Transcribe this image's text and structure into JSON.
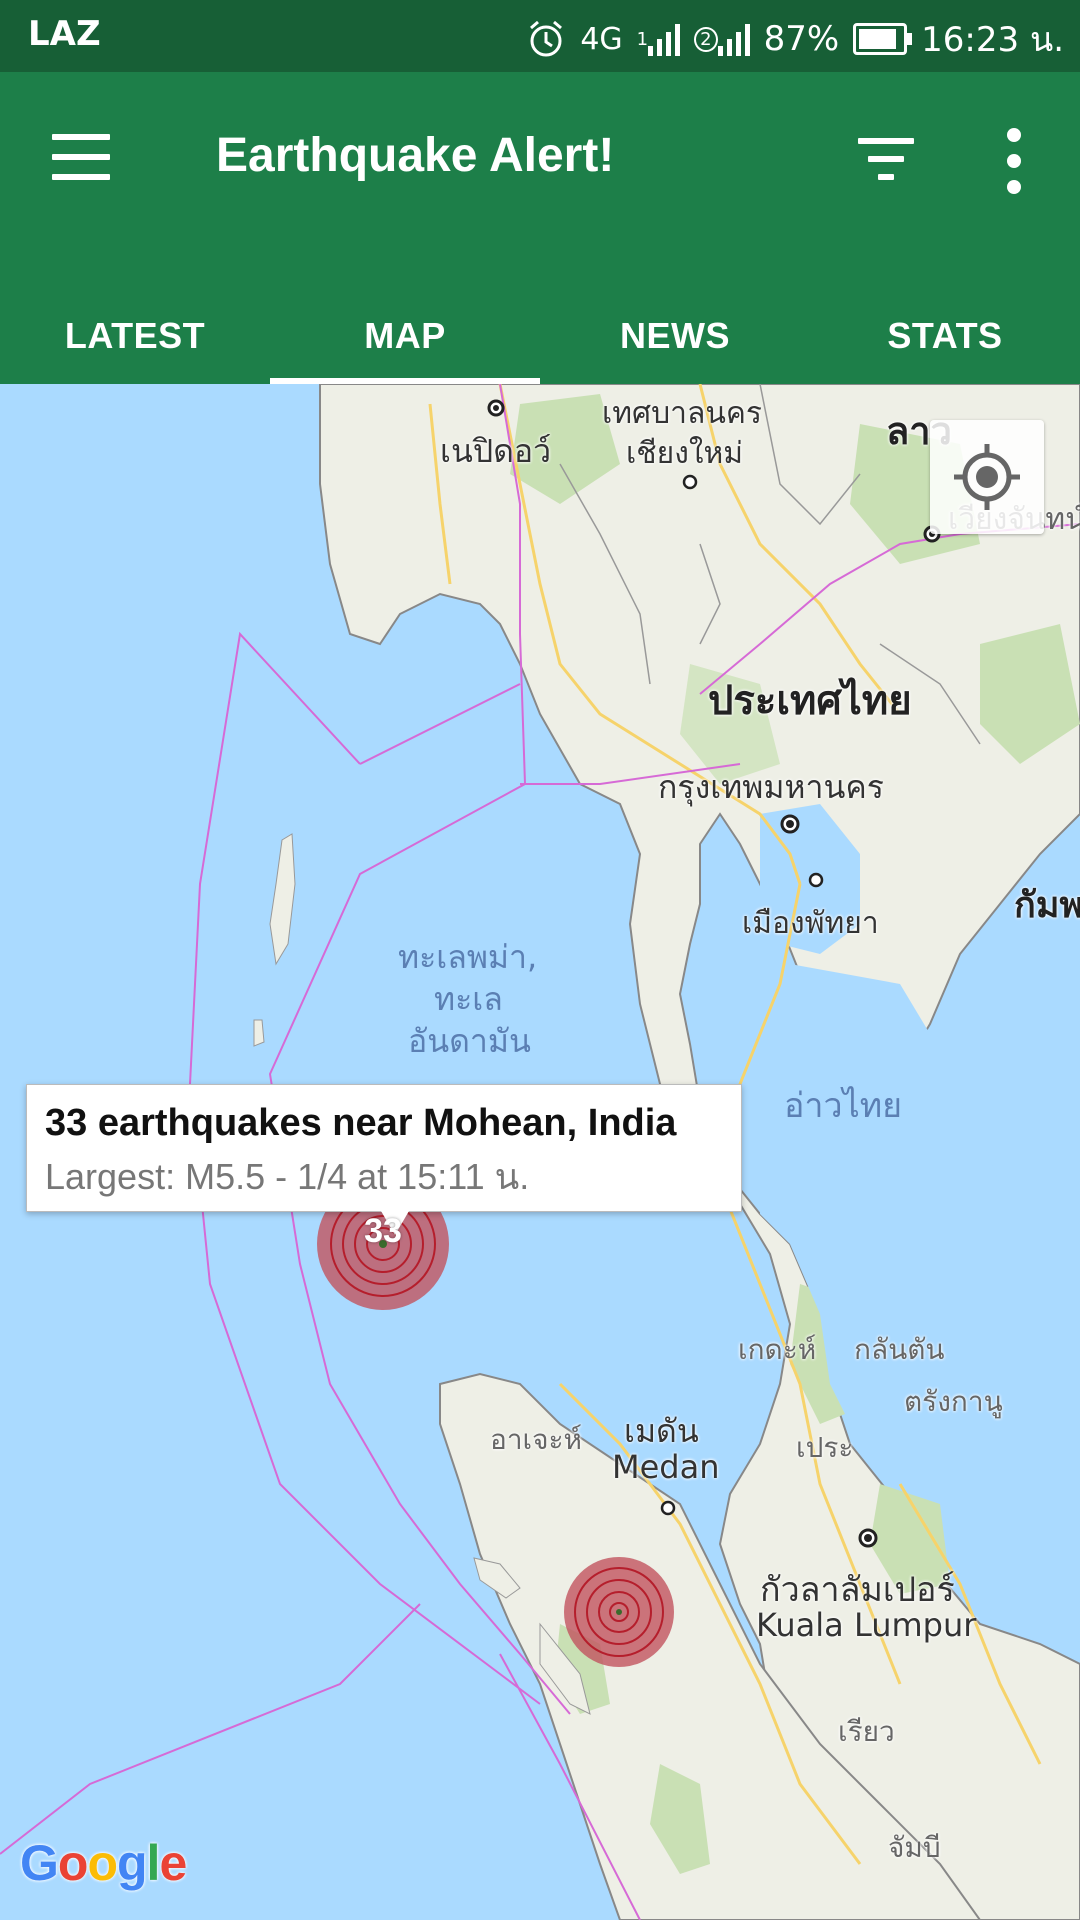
{
  "status_bar": {
    "carrier": "LAZ",
    "network": "4G",
    "sim1": "1",
    "sim2": "2",
    "battery": "87%",
    "battery_level": 0.87,
    "time": "16:23 น."
  },
  "app_bar": {
    "title": "Earthquake Alert!",
    "color": "#1d7f49"
  },
  "tabs": [
    {
      "label": "LATEST",
      "active": false
    },
    {
      "label": "MAP",
      "active": true
    },
    {
      "label": "NEWS",
      "active": false
    },
    {
      "label": "STATS",
      "active": false
    }
  ],
  "map": {
    "labels": {
      "naypyidaw": "เนปิดอว์",
      "chiang_mai_1": "เทศบาลนคร",
      "chiang_mai_2": "เชียงใหม่",
      "laos": "ลาว",
      "vientiane": "เวียงจันทน์",
      "thailand": "ประเทศไทย",
      "bangkok": "กรุงเทพมหานคร",
      "pattaya": "เมืองพัทยา",
      "cambodia": "กัมพ",
      "andaman_1": "ทะเลพม่า,",
      "andaman_2": "ทะเล",
      "andaman_3": "อันดามัน",
      "gulf_thailand": "อ่าวไทย",
      "kedah": "เกดะห์",
      "kelantan": "กลันตัน",
      "terengganu": "ตรังกานู",
      "perak": "เประ",
      "aceh": "อาเจะห์",
      "medan_th": "เมดัน",
      "medan_en": "Medan",
      "kl_th": "กัวลาลัมเปอร์",
      "kl_en": "Kuala Lumpur",
      "riau": "เรียว",
      "jambi": "จัมบี"
    },
    "callout": {
      "title": "33 earthquakes near Mohean, India",
      "subtitle": "Largest: M5.5 - 1/4 at 15:11 น."
    },
    "cluster_count": "33",
    "attribution": "Google"
  }
}
